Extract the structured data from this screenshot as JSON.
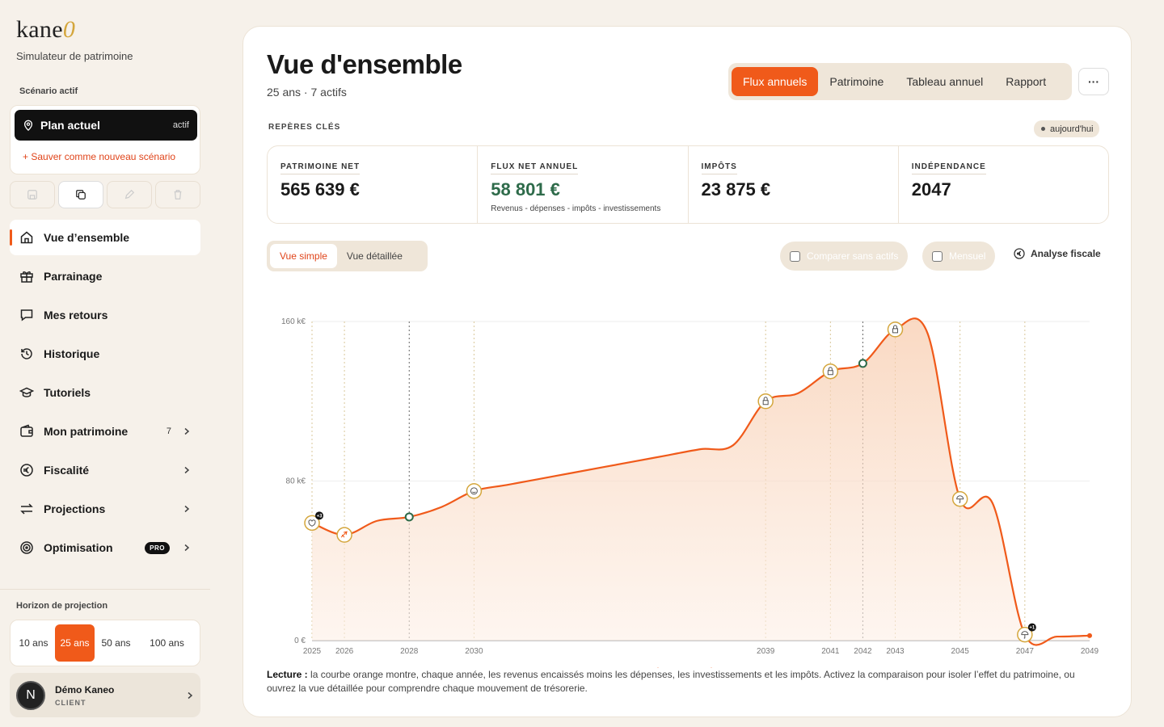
{
  "brand": {
    "logo_text": "kane",
    "logo_accent": "0",
    "tagline": "Simulateur de patrimoine"
  },
  "scenario": {
    "label": "Scénario actif",
    "name": "Plan actuel",
    "state": "actif",
    "save_new": "+ Sauver comme nouveau scénario"
  },
  "nav": [
    {
      "label": "Vue d’ensemble",
      "icon": "home-icon",
      "active": true
    },
    {
      "label": "Parrainage",
      "icon": "gift-icon"
    },
    {
      "label": "Mes retours",
      "icon": "message-icon"
    },
    {
      "label": "Historique",
      "icon": "history-icon"
    },
    {
      "label": "Tutoriels",
      "icon": "graduation-cap-icon"
    },
    {
      "label": "Mon patrimoine",
      "icon": "wallet-icon",
      "count": "7",
      "chevron": true
    },
    {
      "label": "Fiscalité",
      "icon": "euro-icon",
      "chevron": true
    },
    {
      "label": "Projections",
      "icon": "arrows-icon",
      "chevron": true
    },
    {
      "label": "Optimisation",
      "icon": "target-icon",
      "badge": "PRO",
      "chevron": true
    }
  ],
  "horizon": {
    "label": "Horizon de projection",
    "options": [
      "10 ans",
      "25 ans",
      "50 ans",
      "100 ans"
    ],
    "selected": "25 ans"
  },
  "user": {
    "initial": "N",
    "name": "Démo Kaneo",
    "role": "CLIENT"
  },
  "page": {
    "title": "Vue d'ensemble",
    "subtitle": "25 ans · 7 actifs",
    "tabs": [
      "Flux annuels",
      "Patrimoine",
      "Tableau annuel",
      "Rapport"
    ],
    "active_tab": "Flux annuels",
    "more": "···",
    "reperes_label": "REPÈRES CLÉS",
    "today": "aujourd'hui"
  },
  "kpis": [
    {
      "label": "PATRIMOINE NET",
      "value": "565 639 €"
    },
    {
      "label": "FLUX NET ANNUEL",
      "value": "58 801 €",
      "sub": "Revenus - dépenses - impôts - investissements"
    },
    {
      "label": "IMPÔTS",
      "value": "23 875 €"
    },
    {
      "label": "INDÉPENDANCE",
      "value": "2047"
    }
  ],
  "view_toggle": {
    "options": [
      "Vue simple",
      "Vue détaillée"
    ],
    "selected": "Vue simple"
  },
  "toggles": {
    "compare": "Comparer sans actifs",
    "monthly": "Mensuel",
    "fiscal": "Analyse fiscale"
  },
  "colors": {
    "accent": "#f05a1a",
    "green": "#2e6b4a",
    "gold": "#d4a63c"
  },
  "chart_data": {
    "type": "area",
    "series": [
      {
        "name": "Flux net annuel",
        "values": [
          [
            2025,
            59
          ],
          [
            2026,
            53
          ],
          [
            2027,
            60
          ],
          [
            2028,
            62
          ],
          [
            2029,
            67
          ],
          [
            2030,
            75
          ],
          [
            2031,
            78
          ],
          [
            2032,
            81
          ],
          [
            2033,
            84
          ],
          [
            2034,
            87
          ],
          [
            2035,
            90
          ],
          [
            2036,
            93
          ],
          [
            2037,
            96
          ],
          [
            2038,
            98
          ],
          [
            2039,
            120
          ],
          [
            2040,
            124
          ],
          [
            2041,
            135
          ],
          [
            2042,
            139
          ],
          [
            2043,
            156
          ],
          [
            2044,
            154
          ],
          [
            2045,
            71
          ],
          [
            2046,
            69
          ],
          [
            2047,
            3
          ],
          [
            2048,
            2
          ],
          [
            2049,
            2.5
          ]
        ]
      }
    ],
    "x_ticks": [
      "2025",
      "2026",
      "2028",
      "2030",
      "2039",
      "2041",
      "2042",
      "2043",
      "2045",
      "2047",
      "2049"
    ],
    "y_ticks": [
      "0 €",
      "80 k€",
      "160 k€"
    ],
    "ylim": [
      0,
      160
    ],
    "unit": "k€",
    "markers": [
      {
        "year": 2025,
        "icon": "heart-icon",
        "badge": "+3"
      },
      {
        "year": 2026,
        "icon": "plane-icon"
      },
      {
        "year": 2028,
        "icon": "dot"
      },
      {
        "year": 2030,
        "icon": "smile-icon"
      },
      {
        "year": 2039,
        "icon": "lock-icon"
      },
      {
        "year": 2041,
        "icon": "lock-icon"
      },
      {
        "year": 2042,
        "icon": "dot"
      },
      {
        "year": 2043,
        "icon": "lock-icon"
      },
      {
        "year": 2045,
        "icon": "umbrella-icon"
      },
      {
        "year": 2047,
        "icon": "umbrella-icon",
        "badge": "+1"
      }
    ],
    "grid": true,
    "legend": "bottom-center"
  },
  "lecture": {
    "bold": "Lecture :",
    "text": " la courbe orange montre, chaque année, les revenus encaissés moins les dépenses, les investissements et les impôts. Activez la comparaison pour isoler l’effet du patrimoine, ou ouvrez la vue détaillée pour comprendre chaque mouvement de trésorerie."
  }
}
